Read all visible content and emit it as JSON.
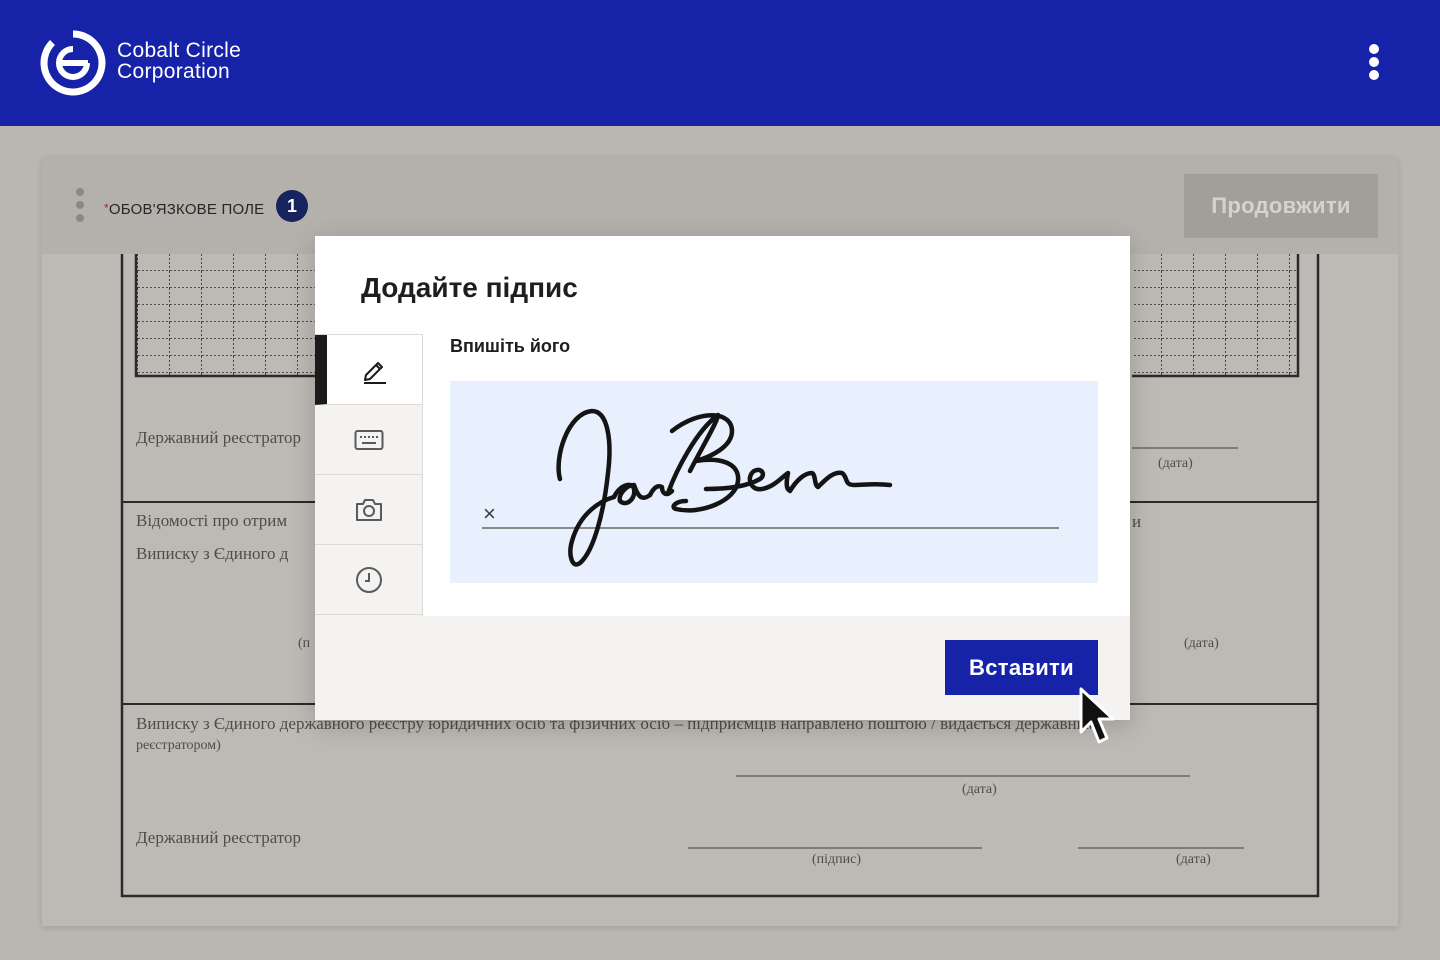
{
  "header": {
    "brand_line1": "Cobalt Circle",
    "brand_line2": "Corporation",
    "colors": {
      "bar": "#1623a8",
      "text": "#ffffff"
    }
  },
  "toolbar": {
    "required_star": "*",
    "required_label": "ОБОВ'ЯЗКОВЕ ПОЛЕ",
    "required_count": "1",
    "continue_label": "Продовжити"
  },
  "document": {
    "row1_label": "Державний реєстратор",
    "row1_date": "(дата)",
    "row2_line1": "Відомості про отрим",
    "row2_line2": "Виписку з Єдиного д",
    "row2_right": "и",
    "row2_sign_left": "(п",
    "row2_date": "(дата)",
    "row3_line1": "Виписку з Єдиного державного реєстру юридичних осіб та фізичних осіб – підприємців направлено поштою / видається державним",
    "row3_line2": "реєстратором)",
    "row3_date": "(дата)",
    "row4_label": "Державний реєстратор",
    "row4_sign": "(підпис)",
    "row4_date": "(дата)"
  },
  "modal": {
    "title": "Додайте підпис",
    "field_label": "Впишіть його",
    "clear_glyph": "×",
    "insert_label": "Вставити",
    "tabs": [
      {
        "icon": "pencil-icon",
        "active": true
      },
      {
        "icon": "keyboard-icon",
        "active": false
      },
      {
        "icon": "camera-icon",
        "active": false
      },
      {
        "icon": "clock-icon",
        "active": false
      }
    ],
    "colors": {
      "accent": "#1623a8",
      "signature_bg": "#e8effd"
    }
  }
}
